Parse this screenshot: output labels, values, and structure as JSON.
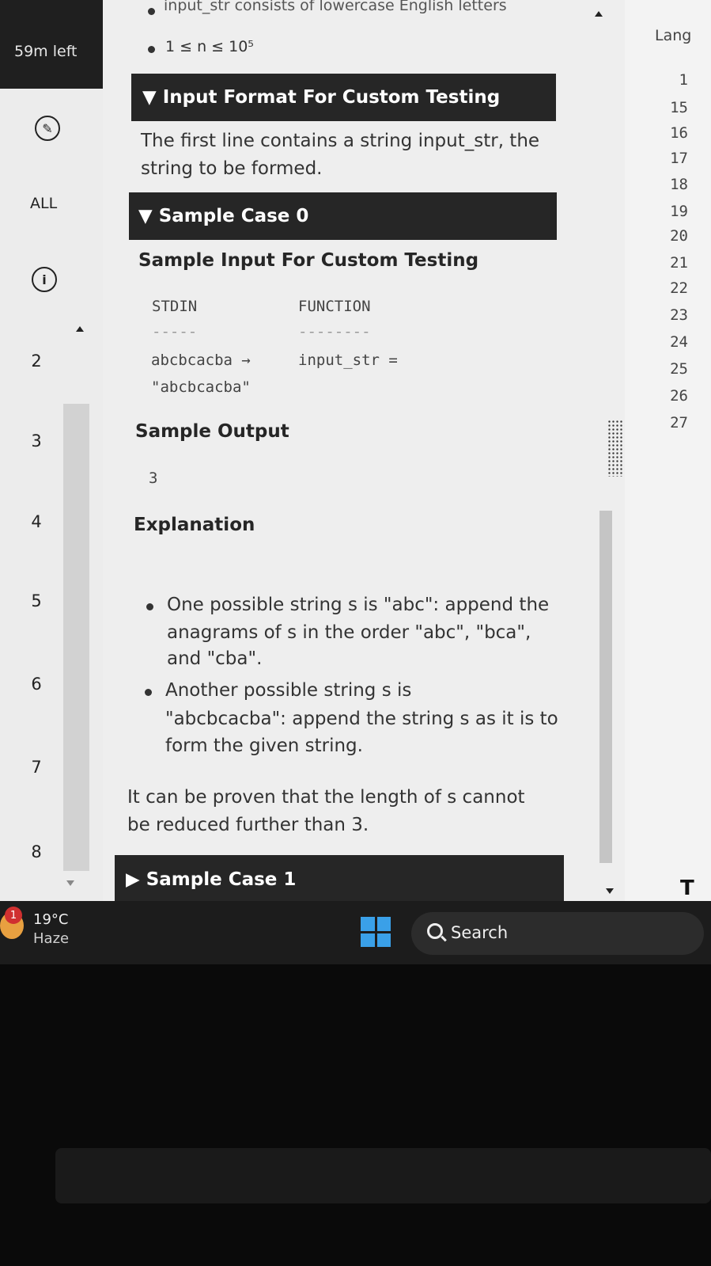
{
  "timer": {
    "text": "59m left"
  },
  "sidebar": {
    "all_label": "ALL",
    "question_numbers": [
      "2",
      "3",
      "4",
      "5",
      "6",
      "7",
      "8"
    ]
  },
  "problem": {
    "constraint_partial": "input_str consists of lowercase English letters",
    "constraint_n": "1 ≤ n ≤ 10⁵",
    "input_format_header": "▼ Input Format For Custom Testing",
    "input_format_text_line1": "The first line contains a string input_str, the",
    "input_format_text_line2": "string to be formed.",
    "sample_case0_header": "▼ Sample Case 0",
    "sample_input_heading": "Sample Input For Custom Testing",
    "stdin_label": "STDIN",
    "function_label": "FUNCTION",
    "stdin_dashes": "-----",
    "function_dashes": "--------",
    "stdin_value": "abcbcacba →",
    "function_value": "input_str =",
    "stdin_value_line2": "\"abcbcacba\"",
    "sample_output_heading": "Sample Output",
    "sample_output_value": "3",
    "explanation_heading": "Explanation",
    "bullet1_line1": "One possible string s is \"abc\": append the",
    "bullet1_line2": "anagrams of s in the order \"abc\", \"bca\",",
    "bullet1_line3": "and \"cba\".",
    "bullet2_line1": "Another possible string s is",
    "bullet2_line2": "\"abcbcacba\": append the string s as it is to",
    "bullet2_line3": "form the given string.",
    "conclusion_line1": "It can be proven that the length of s cannot",
    "conclusion_line2": "be reduced further than 3.",
    "sample_case1_header": "▶ Sample Case 1"
  },
  "editor": {
    "language_label": "Lang",
    "line_numbers": [
      "1",
      "15",
      "16",
      "17",
      "18",
      "19",
      "20",
      "21",
      "22",
      "23",
      "24",
      "25",
      "26",
      "27"
    ],
    "partial_label": "T"
  },
  "taskbar": {
    "weather_badge": "1",
    "weather_temp": "19°C",
    "weather_desc": "Haze",
    "search_label": "Search"
  },
  "colors": {
    "header_bar": "#262626",
    "windows_logo": "#3aa0e8",
    "taskbar": "#1c1c1c"
  },
  "icons": [
    "pen-icon",
    "info-icon",
    "search-icon",
    "windows-logo-icon",
    "weather-icon",
    "drag-handle-icon"
  ]
}
